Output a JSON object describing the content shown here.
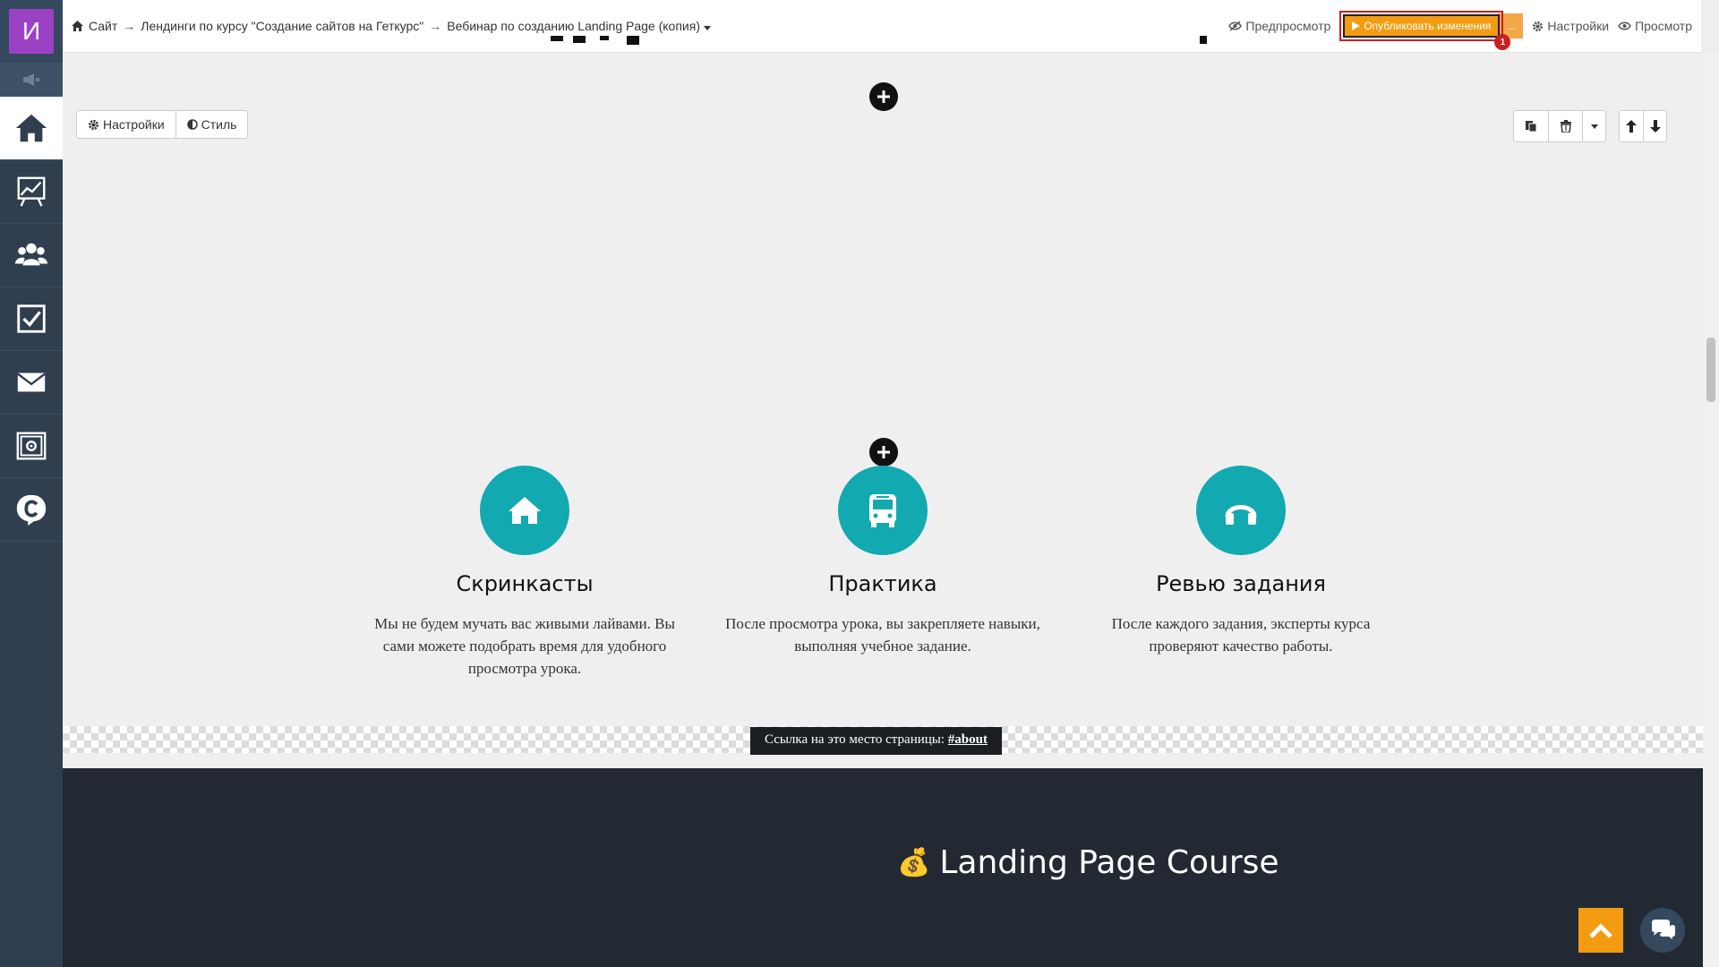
{
  "sidebar": {
    "logo_letter": "И",
    "items": [
      {
        "icon": "home-icon",
        "active": true
      },
      {
        "icon": "chart-board-icon"
      },
      {
        "icon": "users-icon"
      },
      {
        "icon": "checkbox-icon"
      },
      {
        "icon": "envelope-icon"
      },
      {
        "icon": "safe-icon"
      },
      {
        "icon": "chat-c-icon"
      }
    ]
  },
  "topbar": {
    "breadcrumb": {
      "site": "Сайт",
      "sep1": "→",
      "section": "Лендинги по курсу \"Создание сайтов на Геткурс\"",
      "sep2": "→",
      "page": "Вебинар по созданию Landing Page (копия)"
    },
    "preview_label": "Предпросмотр",
    "publish_label": "Опубликовать изменения",
    "more_label": "...",
    "badge_count": "1",
    "settings_label": "Настройки",
    "view_label": "Просмотр"
  },
  "block_tools": {
    "settings_label": "Настройки",
    "style_label": "Стиль"
  },
  "features": [
    {
      "icon": "home-icon",
      "title": "Скринкасты",
      "text": "Мы не будем мучать вас живыми лайвами. Вы сами можете подобрать время для удобного просмотра урока."
    },
    {
      "icon": "bus-icon",
      "title": "Практика",
      "text": "После просмотра урока, вы закрепляете навыки, выполняя учебное задание."
    },
    {
      "icon": "headphones-icon",
      "title": "Ревью задания",
      "text": "После каждого задания, эксперты курса проверяют качество работы."
    }
  ],
  "anchor": {
    "text": "Ссылка на это место страницы: ",
    "link": "#about"
  },
  "dark_section": {
    "emoji": "💰",
    "title": "Landing Page Course"
  },
  "colors": {
    "sidebar_bg": "#2f3f4f",
    "logo_bg": "#9b42c4",
    "accent_orange": "#f39c12",
    "feature_teal": "#12aab0",
    "dark_section_bg": "#222933"
  }
}
